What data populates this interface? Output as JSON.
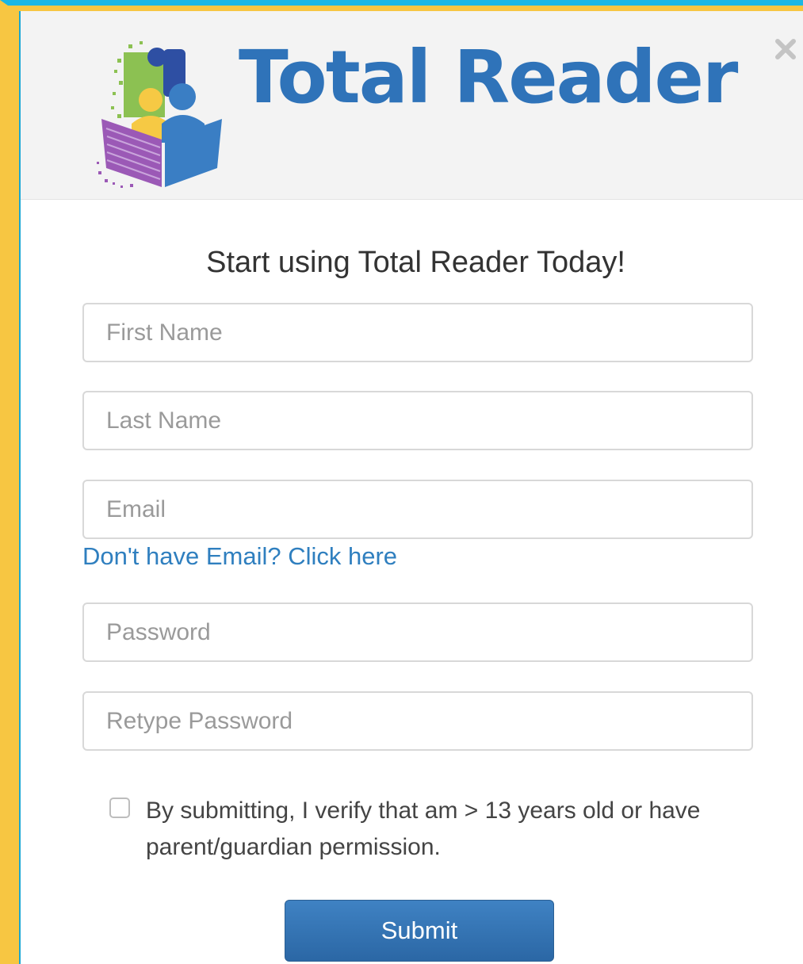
{
  "header": {
    "logo_text": "Total Reader",
    "logo_icon": "reader-book-logo",
    "close_icon": "close-x-icon"
  },
  "form": {
    "heading": "Start using Total Reader Today!",
    "first_name": {
      "placeholder": "First Name",
      "value": ""
    },
    "last_name": {
      "placeholder": "Last Name",
      "value": ""
    },
    "email": {
      "placeholder": "Email",
      "value": ""
    },
    "no_email_link": "Don't have Email? Click here",
    "password": {
      "placeholder": "Password",
      "value": ""
    },
    "retype_password": {
      "placeholder": "Retype Password",
      "value": ""
    },
    "verify_label": "By submitting, I verify that am > 13 years old or have parent/guardian permission.",
    "verify_checked": false,
    "submit_label": "Submit"
  },
  "colors": {
    "brand_blue": "#2f73b9",
    "link_blue": "#2f7fbf",
    "frame_yellow": "#f7c642",
    "frame_cyan": "#1bb7e4"
  }
}
